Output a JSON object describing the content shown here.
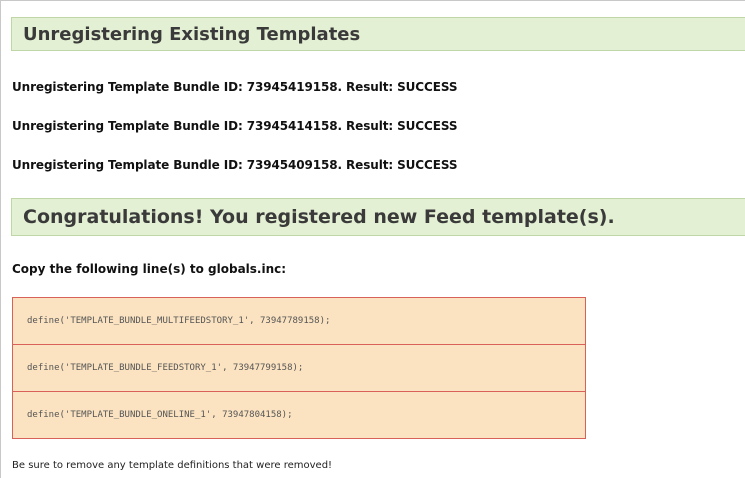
{
  "section_unregister": {
    "title": "Unregistering Existing Templates",
    "results": [
      "Unregistering Template Bundle ID: 73945419158. Result: SUCCESS",
      "Unregistering Template Bundle ID: 73945414158. Result: SUCCESS",
      "Unregistering Template Bundle ID: 73945409158. Result: SUCCESS"
    ]
  },
  "section_register": {
    "title": "Congratulations! You registered new Feed template(s).",
    "instruction": "Copy the following line(s) to globals.inc:",
    "defines": [
      "define('TEMPLATE_BUNDLE_MULTIFEEDSTORY_1', 73947789158);",
      "define('TEMPLATE_BUNDLE_FEEDSTORY_1', 73947799158);",
      "define('TEMPLATE_BUNDLE_ONELINE_1', 73947804158);"
    ],
    "footer_note": "Be sure to remove any template definitions that were removed!"
  },
  "colors": {
    "header_background": "#e3f0d3",
    "header_border": "#bfd7a7",
    "code_background": "#fbe3c1",
    "code_border": "#d8625a"
  }
}
